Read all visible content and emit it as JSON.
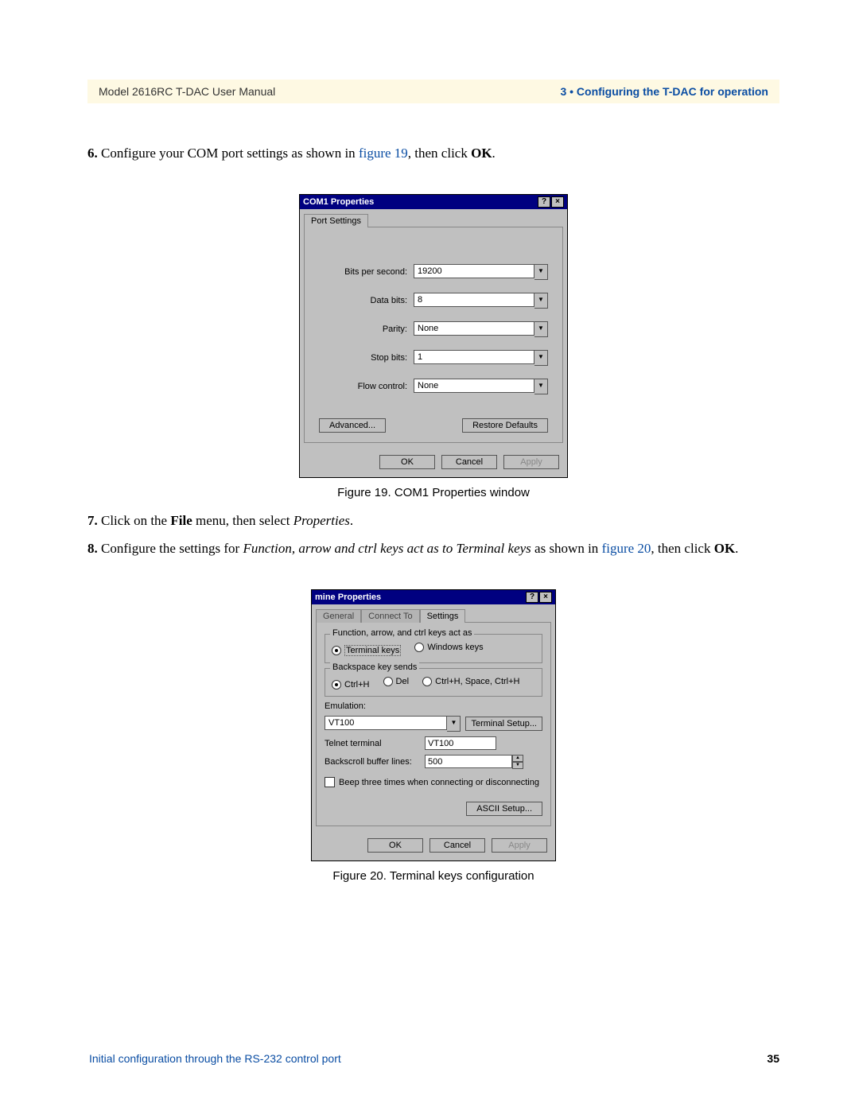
{
  "header": {
    "left": "Model 2616RC T-DAC User Manual",
    "right": "3 • Configuring the T-DAC for operation"
  },
  "steps": {
    "s6_num": "6.",
    "s6_a": "Configure your COM port settings as shown in ",
    "s6_link": "figure 19",
    "s6_b": ", then click ",
    "s6_ok": "OK",
    "s6_c": ".",
    "s7_num": "7.",
    "s7_a": "Click on the ",
    "s7_file": "File",
    "s7_b": " menu, then select ",
    "s7_prop": "Properties",
    "s7_c": ".",
    "s8_num": "8.",
    "s8_a": "Configure the settings for ",
    "s8_ital": "Function, arrow and ctrl keys act as to Terminal keys",
    "s8_b": " as shown in ",
    "s8_link": "figure 20",
    "s8_c": ", then click ",
    "s8_ok": "OK",
    "s8_d": "."
  },
  "fig19_caption": "Figure 19. COM1 Properties window",
  "fig20_caption": "Figure 20. Terminal keys configuration",
  "dlg1": {
    "title": "COM1 Properties",
    "tab": "Port Settings",
    "bits_per_second_label": "Bits per second:",
    "bits_per_second": "19200",
    "data_bits_label": "Data bits:",
    "data_bits": "8",
    "parity_label": "Parity:",
    "parity": "None",
    "stop_bits_label": "Stop bits:",
    "stop_bits": "1",
    "flow_control_label": "Flow control:",
    "flow_control": "None",
    "advanced": "Advanced...",
    "restore": "Restore Defaults",
    "ok": "OK",
    "cancel": "Cancel",
    "apply": "Apply"
  },
  "dlg2": {
    "title": "mine Properties",
    "tab_general": "General",
    "tab_connect": "Connect To",
    "tab_settings": "Settings",
    "group1_title": "Function, arrow, and ctrl keys act as",
    "opt_terminal": "Terminal keys",
    "opt_windows": "Windows keys",
    "group2_title": "Backspace key sends",
    "opt_ctrlh": "Ctrl+H",
    "opt_del": "Del",
    "opt_chsch": "Ctrl+H, Space, Ctrl+H",
    "emulation_label": "Emulation:",
    "emulation": "VT100",
    "terminal_setup": "Terminal Setup...",
    "telnet_label": "Telnet terminal",
    "telnet_value": "VT100",
    "backscroll_label": "Backscroll buffer lines:",
    "backscroll_value": "500",
    "beep": "Beep three times when connecting or disconnecting",
    "ascii_setup": "ASCII Setup...",
    "ok": "OK",
    "cancel": "Cancel",
    "apply": "Apply"
  },
  "footer": {
    "left": "Initial configuration through the RS-232 control port",
    "page": "35"
  }
}
